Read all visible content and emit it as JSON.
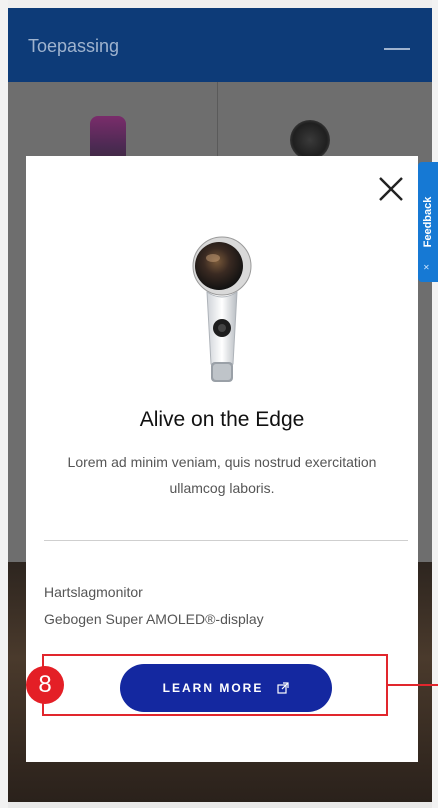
{
  "backdrop": {
    "header_title": "Toepassing"
  },
  "feedback": {
    "label": "Feedback"
  },
  "modal": {
    "title": "Alive on the Edge",
    "description": "Lorem ad minim veniam, quis nostrud exercitation ullamcog laboris.",
    "features": [
      "Hartslagmonitor",
      "Gebogen Super AMOLED®-display"
    ],
    "cta_label": "LEARN MORE"
  },
  "annotation": {
    "badge_number": "8"
  },
  "colors": {
    "header_bg": "#0d3b78",
    "cta_bg": "#1428a0",
    "feedback_bg": "#1679d4",
    "annotation_red": "#e1262d"
  },
  "icons": {
    "close": "close-icon",
    "external": "external-link-icon",
    "menu": "minus-icon"
  }
}
